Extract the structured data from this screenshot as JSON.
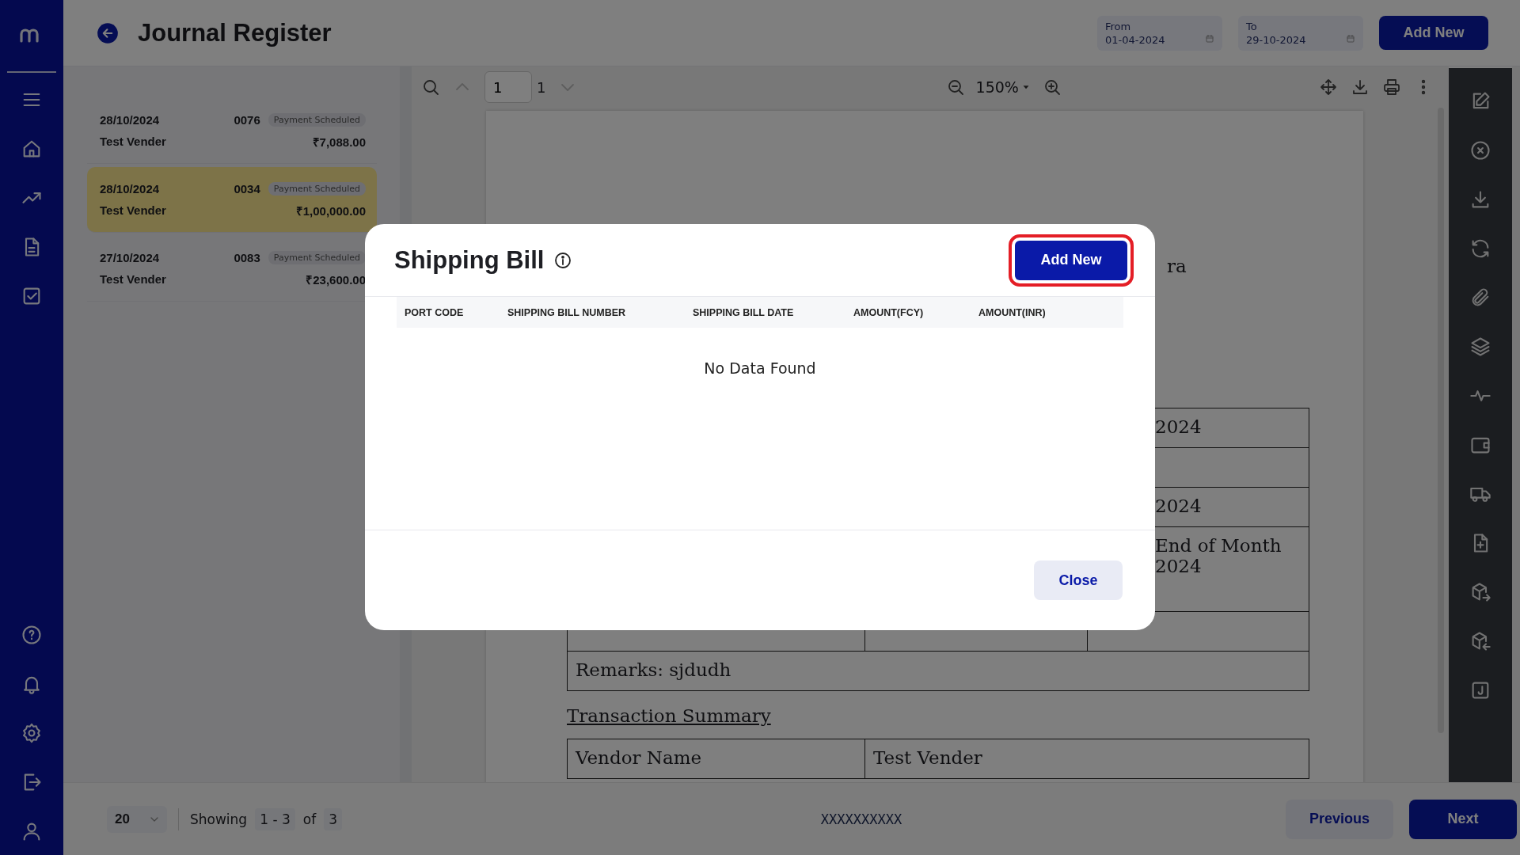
{
  "header": {
    "title": "Journal Register",
    "from": {
      "label": "From",
      "value": "01-04-2024"
    },
    "to": {
      "label": "To",
      "value": "29-10-2024"
    },
    "add_button": "Add New"
  },
  "list": {
    "items": [
      {
        "date": "28/10/2024",
        "number": "0076",
        "status": "Payment Scheduled",
        "vendor": "Test Vender",
        "amount": "₹7,088.00",
        "selected": false
      },
      {
        "date": "28/10/2024",
        "number": "0034",
        "status": "Payment Scheduled",
        "vendor": "Test Vender",
        "amount": "₹1,00,000.00",
        "selected": true
      },
      {
        "date": "27/10/2024",
        "number": "0083",
        "status": "Payment Scheduled",
        "vendor": "Test Vender",
        "amount": "₹23,600.00",
        "selected": false
      }
    ]
  },
  "viewer_toolbar": {
    "page_value": "1",
    "page_count": "1",
    "zoom": "150%"
  },
  "document": {
    "fragment": "ra",
    "rows": [
      {
        "lines": [
          "2024"
        ]
      },
      {
        "lines": []
      },
      {
        "lines": [
          "2024"
        ]
      },
      {
        "lines": [
          "End of Month",
          "2024"
        ]
      }
    ],
    "remarks": "Remarks: sjdudh",
    "section_title": "Transaction Summary",
    "summary_row": [
      "Vendor Name",
      "Test Vender"
    ]
  },
  "pagination": {
    "page_size": "20",
    "showing_label": "Showing",
    "range": "1 - 3",
    "of_label": "of",
    "total": "3",
    "center_text": "XXXXXXXXXX",
    "previous": "Previous",
    "next": "Next"
  },
  "modal": {
    "title": "Shipping Bill",
    "add_button": "Add New",
    "add_highlighted": true,
    "columns": [
      "PORT CODE",
      "SHIPPING BILL NUMBER",
      "SHIPPING BILL DATE",
      "AMOUNT(FCY)",
      "AMOUNT(INR)"
    ],
    "empty_text": "No Data Found",
    "close_button": "Close"
  }
}
